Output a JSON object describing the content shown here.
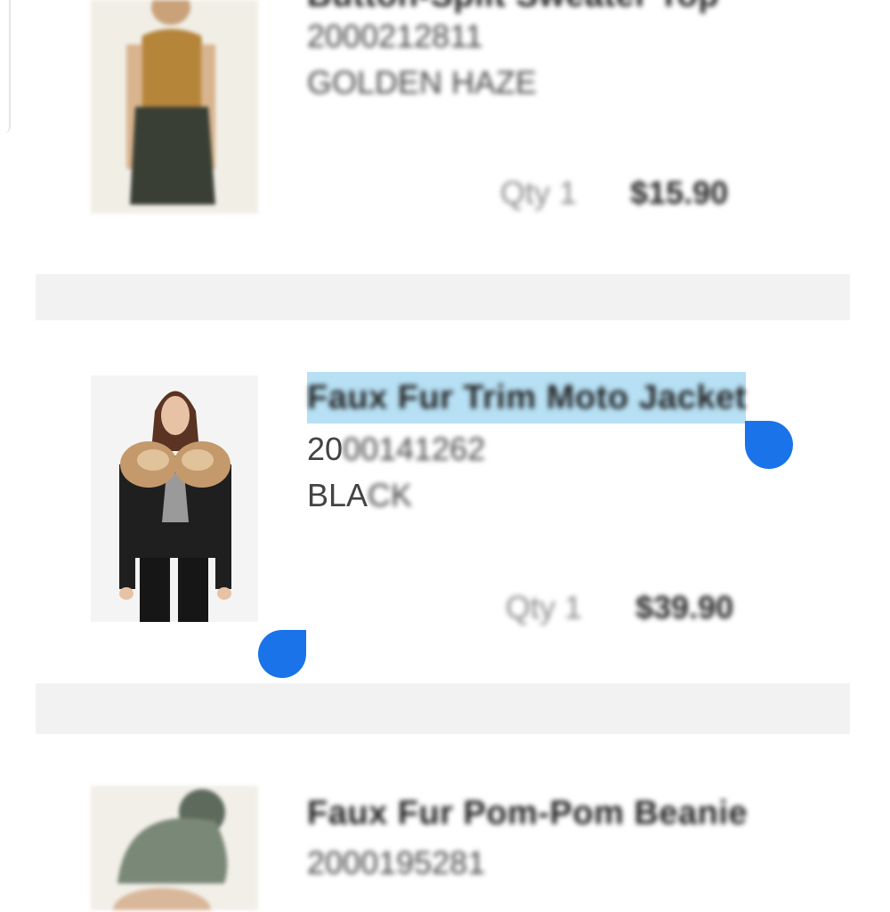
{
  "cart": {
    "items": [
      {
        "title": "Button-Split Sweater Top",
        "sku": "2000212811",
        "color": "GOLDEN HAZE",
        "qty_label": "Qty 1",
        "price": "$15.90"
      },
      {
        "title": "Faux Fur Trim Moto Jacket",
        "sku_prefix": "20",
        "sku_rest": "00141262",
        "color_prefix": "BLA",
        "color_rest": "CK",
        "qty_label": "Qty 1",
        "price": "$39.90"
      },
      {
        "title": "Faux Fur Pom-Pom Beanie",
        "sku": "2000195281"
      }
    ]
  },
  "selection": {
    "handle_color": "#1a73e8",
    "highlight_color": "#b7e0f4"
  },
  "icons": {
    "selection_start": "selection-handle-start-icon",
    "selection_end": "selection-handle-end-icon"
  }
}
